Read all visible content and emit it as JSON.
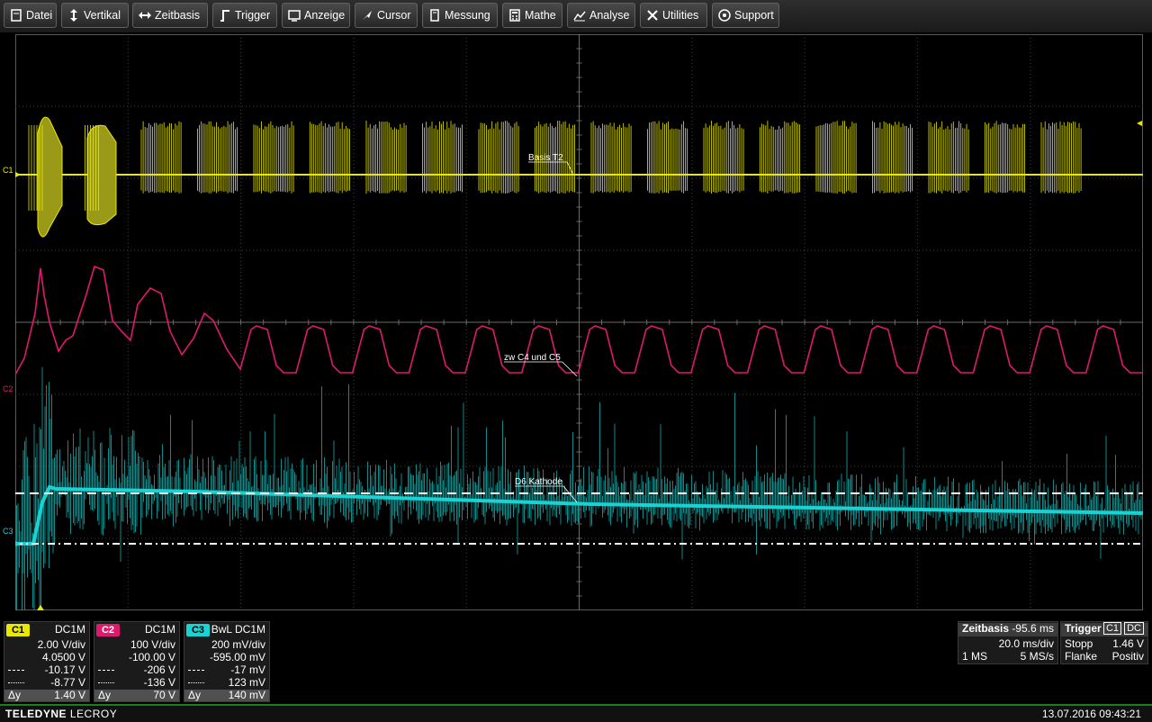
{
  "menu": [
    {
      "label": "Datei",
      "icon": "file-icon"
    },
    {
      "label": "Vertikal",
      "icon": "vertical-arrows-icon"
    },
    {
      "label": "Zeitbasis",
      "icon": "horizontal-arrows-icon"
    },
    {
      "label": "Trigger",
      "icon": "trigger-edge-icon"
    },
    {
      "label": "Anzeige",
      "icon": "display-icon"
    },
    {
      "label": "Cursor",
      "icon": "cursor-arrow-icon"
    },
    {
      "label": "Messung",
      "icon": "measure-icon"
    },
    {
      "label": "Mathe",
      "icon": "calculator-icon"
    },
    {
      "label": "Analyse",
      "icon": "analysis-chart-icon"
    },
    {
      "label": "Utilities",
      "icon": "tools-icon"
    },
    {
      "label": "Support",
      "icon": "support-icon"
    }
  ],
  "colors": {
    "c1": "#e8e800",
    "c2": "#e0196e",
    "c3": "#19d2d2",
    "accent_green": "#1a7f1a"
  },
  "markers": {
    "c1": "C1",
    "c2": "C2",
    "c3": "C3"
  },
  "labels": {
    "c1": "Basis T2",
    "c2": "zw C4 und C5",
    "c3": "D6 Kathode"
  },
  "channels": [
    {
      "badge": "C1",
      "coupling": "DC1M",
      "vdiv": "2.00 V/div",
      "offset": "4.0500 V",
      "cursor1": "-10.17 V",
      "cursor2": "-8.77 V",
      "delta_label": "Δy",
      "delta": "1.40 V"
    },
    {
      "badge": "C2",
      "coupling": "DC1M",
      "vdiv": "100 V/div",
      "offset": "-100.00 V",
      "cursor1": "-206 V",
      "cursor2": "-136 V",
      "delta_label": "Δy",
      "delta": "70 V"
    },
    {
      "badge": "C3",
      "coupling": "BwL DC1M",
      "vdiv": "200 mV/div",
      "offset": "-595.00 mV",
      "cursor1": "-17 mV",
      "cursor2": "123 mV",
      "delta_label": "Δy",
      "delta": "140 mV"
    }
  ],
  "timebase": {
    "title": "Zeitbasis",
    "delay": "-95.6 ms",
    "tdiv": "20.0 ms/div",
    "memory": "1 MS",
    "rate": "5 MS/s"
  },
  "trigger": {
    "title": "Trigger",
    "source": "C1",
    "coupling": "DC",
    "mode": "Stopp",
    "level": "1.46 V",
    "type": "Flanke",
    "slope": "Positiv"
  },
  "footer": {
    "brand": "TELEDYNE",
    "brand2": "LECROY",
    "datetime": "13.07.2016 09:43:21"
  }
}
